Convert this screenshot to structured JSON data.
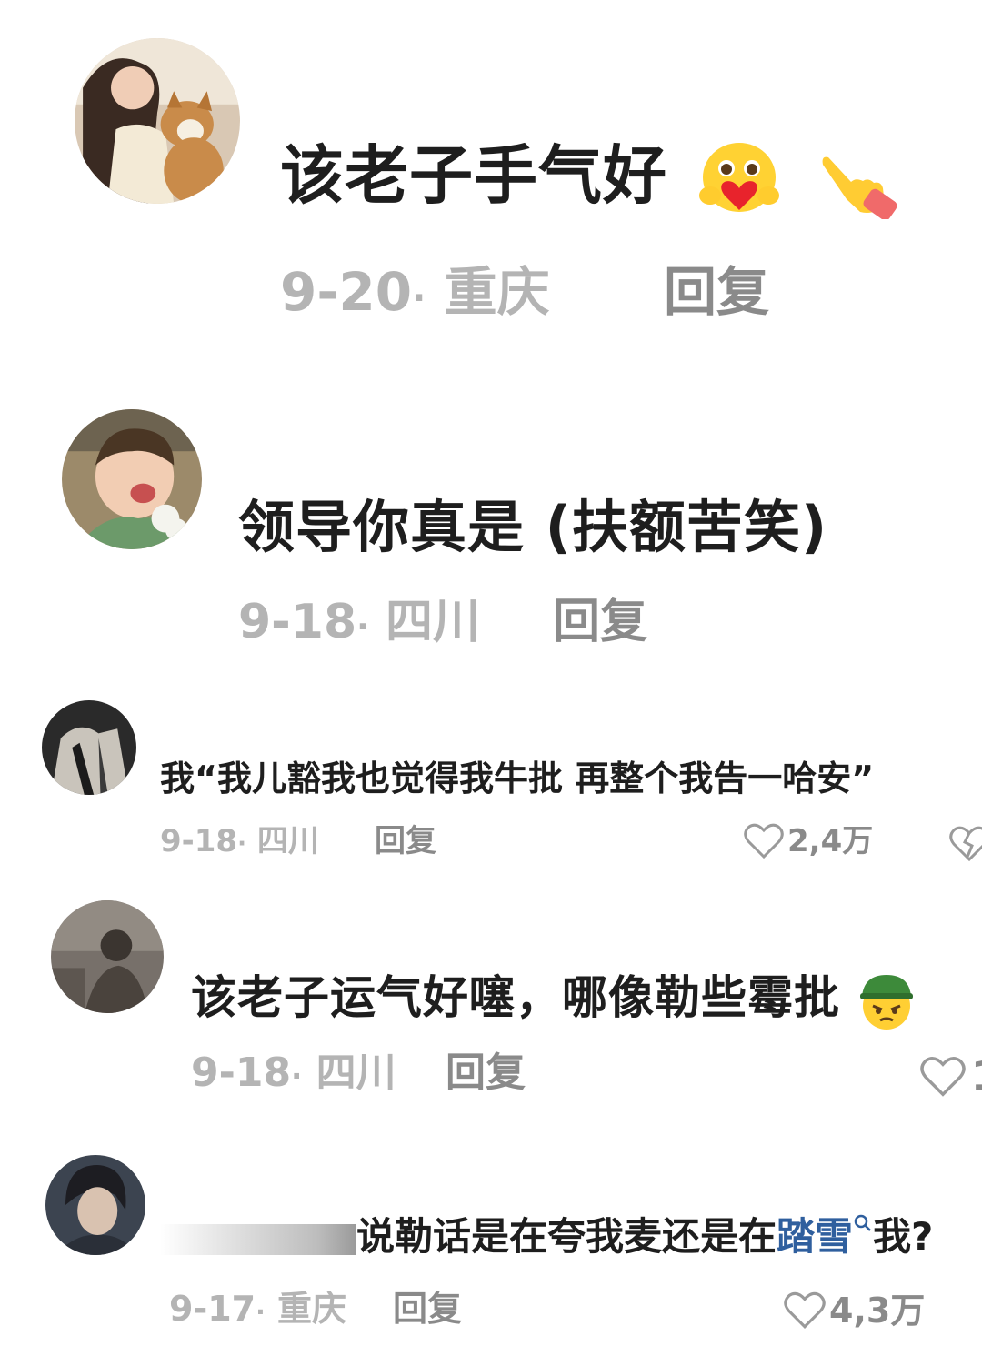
{
  "comments": [
    {
      "text": "该老子手气好",
      "emojis": [
        "heart-hug-emoji",
        "pointing-hand-emoji"
      ],
      "date": "9-20",
      "location": "重庆",
      "reply_label": "回复"
    },
    {
      "text": "领导你真是 (扶额苦笑)",
      "date": "9-18",
      "location": "四川",
      "reply_label": "回复"
    },
    {
      "text": "我“我儿豁我也觉得我牛批 再整个我告一哈安”",
      "date": "9-18",
      "location": "四川",
      "reply_label": "回复",
      "likes": "2,4万"
    },
    {
      "text": "该老子运气好噻，哪像勒些霉批",
      "emojis": [
        "soldier-face-emoji"
      ],
      "date": "9-18",
      "location": "四川",
      "reply_label": "回复",
      "likes": "1"
    },
    {
      "text_prefix": "说勒话是在夸我麦还是在",
      "text_link": "踏雪",
      "text_suffix": "我?",
      "date": "9-17",
      "location": "重庆",
      "reply_label": "回复",
      "likes": "4,3万"
    }
  ],
  "meta_separator": "·",
  "colors": {
    "text": "#1e1e1e",
    "meta": "#b4b4b4",
    "reply": "#8a8a8a",
    "link": "#2f5f9e"
  },
  "icons": [
    "heart-outline-icon",
    "search-small-icon"
  ]
}
